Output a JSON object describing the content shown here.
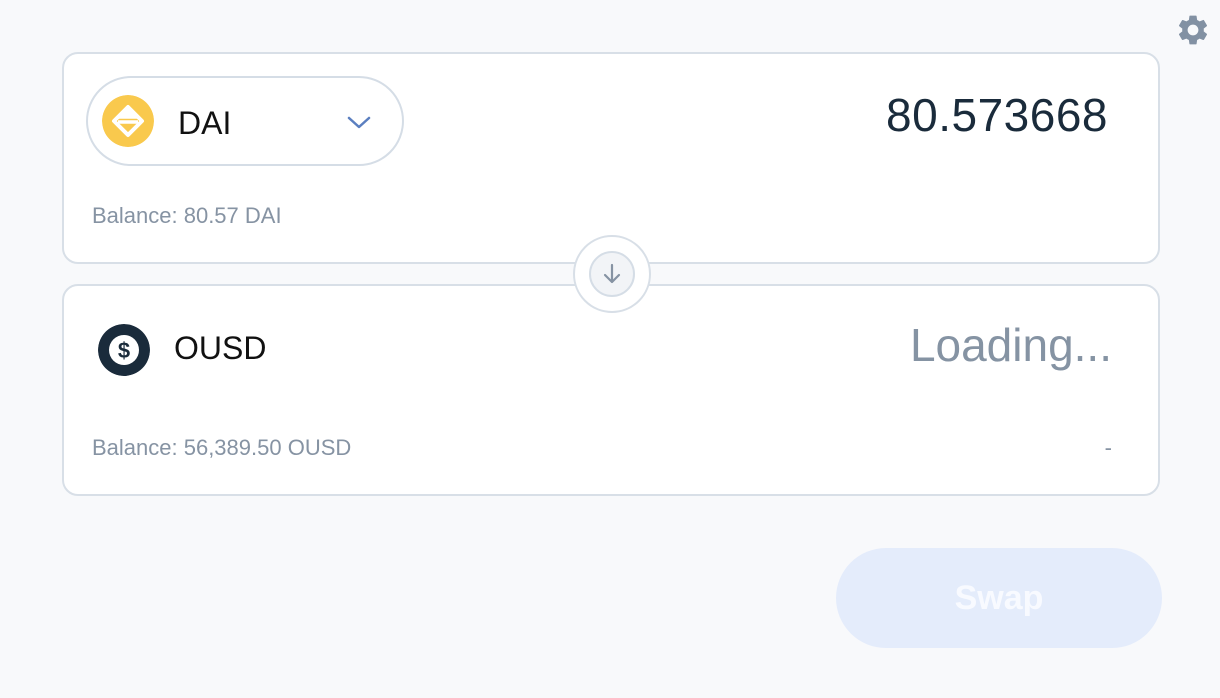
{
  "settings": {
    "icon": "gear-icon",
    "color": "#8291a3"
  },
  "from": {
    "token_icon": "dai-icon",
    "token_color": "#f9c94d",
    "token_symbol": "DAI",
    "amount": "80.573668",
    "balance_label": "Balance: 80.57",
    "balance_symbol": "DAI"
  },
  "to": {
    "token_icon": "ousd-icon",
    "token_color": "#1a2b3b",
    "token_symbol": "OUSD",
    "amount_status": "Loading...",
    "balance_label": "Balance: 56,389.50",
    "balance_symbol": "OUSD",
    "value": "-"
  },
  "swap_direction_icon": "arrow-down-icon",
  "swap_button": {
    "label": "Swap",
    "disabled": true,
    "bg": "#e4ecfb"
  }
}
